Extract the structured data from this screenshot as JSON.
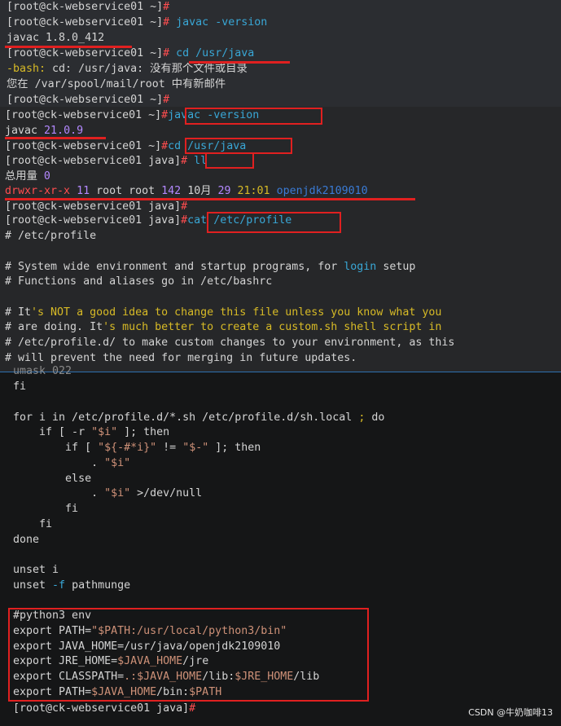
{
  "panel1": {
    "line1": {
      "prompt": "[root@ck-webservice01 ~]",
      "hash": "#"
    },
    "line2": {
      "prompt": "[root@ck-webservice01 ~]",
      "hash": "#",
      "cmd": " javac -version"
    },
    "line3": {
      "text": "javac 1.8.0_412"
    },
    "line4": {
      "prompt": "[root@ck-webservice01 ~]",
      "hash": "#",
      "cmd": " cd /usr/java"
    },
    "line5": {
      "pre": "-bash: ",
      "mid": "cd: /usr/java: ",
      "tail": "没有那个文件或目录"
    },
    "line6": {
      "text": "您在 /var/spool/mail/root 中有新邮件"
    },
    "line7": {
      "prompt": "[root@ck-webservice01 ~]",
      "hash": "#"
    }
  },
  "panel2": {
    "line1": {
      "prompt": "[root@ck-webservice01 ~]",
      "hash": "#",
      "cmd": "javac -version"
    },
    "line2": {
      "pre": "javac ",
      "ver": "21.0.9"
    },
    "line3": {
      "prompt": "[root@ck-webservice01 ~]",
      "hash": "#",
      "cmd": "cd /usr/java"
    },
    "line4": {
      "prompt": "[root@ck-webservice01 java]",
      "hash": "#",
      "cmd": " ll"
    },
    "line5": {
      "pre": "总用量 ",
      "num": "0"
    },
    "line6": {
      "perm": "drwxr-xr-x",
      "links": " 11 ",
      "owner": "root root",
      "size": " 142",
      "month": " 10月 ",
      "day": "29",
      "time": " 21:01 ",
      "name": "openjdk2109010"
    },
    "line7": {
      "prompt": "[root@ck-webservice01 java]",
      "hash": "#"
    },
    "line8": {
      "prompt": "[root@ck-webservice01 java]",
      "hash": "#",
      "cmd": "cat /etc/profile"
    },
    "line9": {
      "text": "# /etc/profile"
    },
    "line11": {
      "a": "# System wide environment and startup programs, for ",
      "b": "login",
      "c": " setup"
    },
    "line12": {
      "text": "# Functions and aliases go in /etc/bashrc"
    },
    "line14": {
      "a": "# It",
      "b": "'s NOT a good idea to change this file unless you know what you"
    },
    "line15": {
      "a": "# are doing. It",
      "b": "'s much better to create a custom.sh shell script in"
    },
    "line16": {
      "text": "# /etc/profile.d/ to make custom changes to your environment, as this"
    },
    "line17": {
      "text": "# will prevent the need for merging in future updates."
    }
  },
  "panel3": {
    "cut": "  umask 022",
    "l1": "  fi",
    "l3a": "  for i in /etc/profile.d/*.sh /etc/profile.d/sh.local ",
    "l3b": "; ",
    "l3c": "do",
    "l4a": "      if [ -r ",
    "l4b": "\"$i\"",
    "l4c": " ]; then",
    "l5a": "          if [ ",
    "l5b": "\"${-#*i}\"",
    "l5c": " != ",
    "l5d": "\"$-\"",
    "l5e": " ]; then",
    "l6a": "              . ",
    "l6b": "\"$i\"",
    "l7": "          else",
    "l8a": "              . ",
    "l8b": "\"$i\"",
    "l8c": " >/dev/null",
    "l9": "          fi",
    "l10": "      fi",
    "l11": "  done",
    "l13": "  unset i",
    "l14a": "  unset ",
    "l14b": "-f",
    "l14c": " pathmunge",
    "l16": "  #python3 env",
    "l17a": "  export PATH=",
    "l17b": "\"$PATH:/usr/local/python3/bin\"",
    "l18a": "  export JAVA_HOME=",
    "l18b": "/usr/java/openjdk2109010",
    "l19a": "  export JRE_HOME=",
    "l19b": "$JAVA_HOME",
    "l19c": "/jre",
    "l20a": "  export CLASSPATH=",
    "l20b": ".:$JAVA_HOME",
    "l20c": "/lib:",
    "l20d": "$JRE_HOME",
    "l20e": "/lib",
    "l21a": "  export PATH=",
    "l21b": "$JAVA_HOME",
    "l21c": "/bin:",
    "l21d": "$PATH",
    "last": {
      "prompt": "  [root@ck-webservice01 java]",
      "hash": "#"
    }
  },
  "watermark": "CSDN @牛奶咖啡13",
  "colors": {
    "prompt_hash": "#ff4d4f",
    "command": "#39a7d6",
    "highlight_box": "#e02020",
    "version": "#b388ff"
  }
}
